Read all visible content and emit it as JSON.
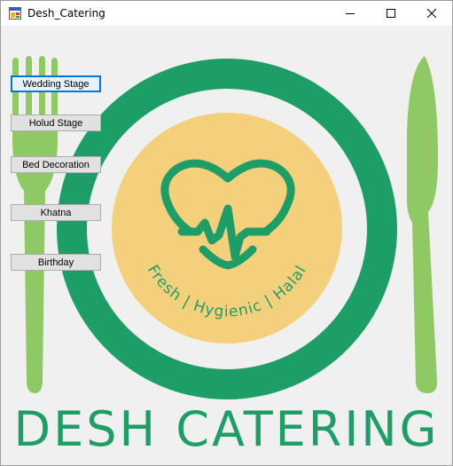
{
  "window": {
    "title": "Desh_Catering"
  },
  "titlebar_icons": {
    "app": "winforms-app-icon",
    "minimize": "minimize-icon",
    "maximize": "maximize-icon",
    "close": "close-icon"
  },
  "buttons": [
    {
      "label": "Wedding Stage",
      "focused": true
    },
    {
      "label": "Holud Stage"
    },
    {
      "label": "Bed Decoration"
    },
    {
      "label": "Khatna"
    },
    {
      "label": "Birthday"
    }
  ],
  "logo": {
    "tagline": "Fresh | Hygienic | Halal",
    "brand": "DESH CATERING"
  },
  "colors": {
    "plate_green": "#1d9e66",
    "plate_inner": "#f0f0f0",
    "center_yellow": "#f5d07c",
    "cutlery_green": "#8fc963",
    "focus_blue": "#0078d7"
  }
}
